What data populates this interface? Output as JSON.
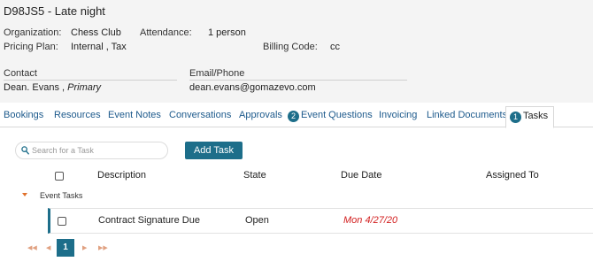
{
  "event": {
    "title": "D98JS5 - Late night",
    "organization_label": "Organization:",
    "organization": "Chess Club",
    "attendance_label": "Attendance:",
    "attendance": "1 person",
    "pricing_label": "Pricing Plan:",
    "pricing": "Internal , Tax",
    "billing_label": "Billing Code:",
    "billing": "cc",
    "contact_label": "Contact",
    "contact_name": "Dean. Evans ,",
    "contact_role": "Primary",
    "email_label": "Email/Phone",
    "email": "dean.evans@gomazevo.com"
  },
  "tabs": [
    {
      "label": "Bookings"
    },
    {
      "label": "Resources"
    },
    {
      "label": "Event Notes"
    },
    {
      "label": "Conversations"
    },
    {
      "label": "Approvals"
    },
    {
      "label": "Event Questions",
      "badge": "2"
    },
    {
      "label": "Invoicing"
    },
    {
      "label": "Linked Documents"
    },
    {
      "label": "Tasks",
      "badge": "1",
      "active": true
    }
  ],
  "tasks": {
    "search_placeholder": "Search for a Task",
    "add_label": "Add Task",
    "columns": {
      "description": "Description",
      "state": "State",
      "due_date": "Due Date",
      "assigned_to": "Assigned To"
    },
    "group_label": "Event Tasks",
    "rows": [
      {
        "description": "Contract Signature Due",
        "state": "Open",
        "due_date": "Mon 4/27/20",
        "assigned_to": ""
      }
    ],
    "pager": {
      "current_page": "1",
      "first_icon": "first-page-icon",
      "prev_icon": "prev-page-icon",
      "next_icon": "next-page-icon",
      "last_icon": "last-page-icon"
    }
  },
  "colors": {
    "accent": "#1d6e8a",
    "link": "#1d5a8c",
    "overdue": "#d21e1e",
    "header_bg": "#f4f4f4",
    "group_arrow": "#e0702a"
  }
}
